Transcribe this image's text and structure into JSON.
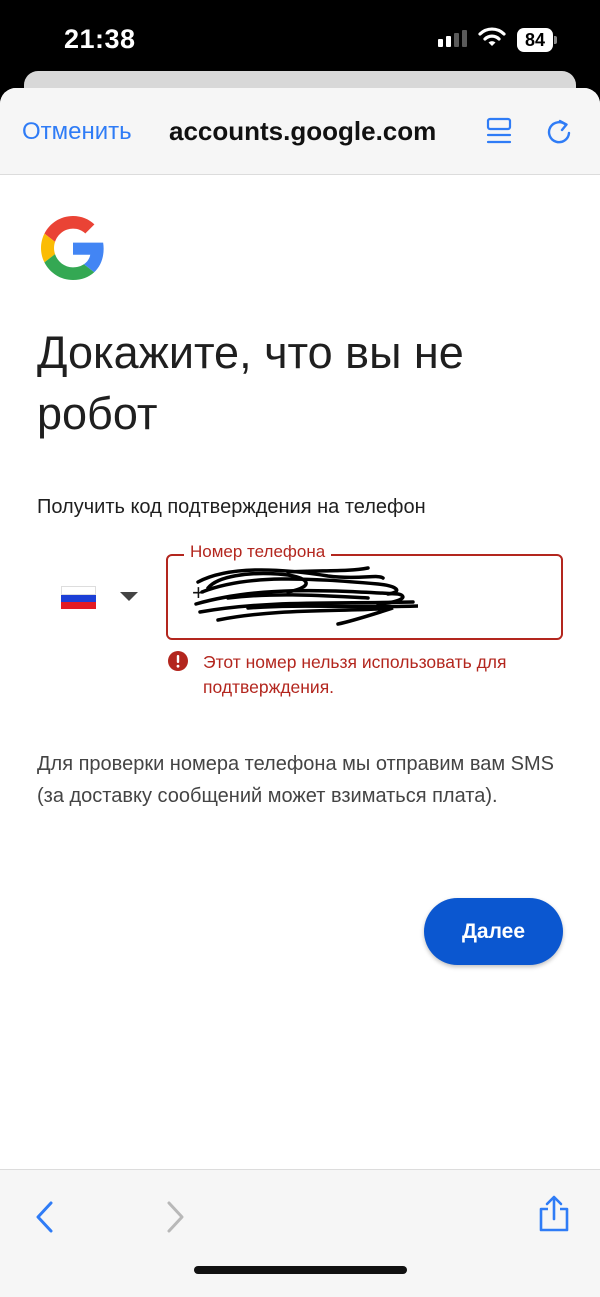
{
  "status_bar": {
    "time": "21:38",
    "battery_level": "84",
    "icons": [
      "cellular-signal-icon",
      "wifi-icon",
      "battery-icon"
    ]
  },
  "browser_nav": {
    "cancel_label": "Отменить",
    "url": "accounts.google.com",
    "icons": [
      "reader-mode-icon",
      "reload-icon"
    ]
  },
  "page": {
    "title": "Докажите, что вы не робот",
    "subtitle": "Получить код подтверждения на телефон",
    "country": {
      "flag": "russia-flag",
      "flag_colors": [
        "#ffffff",
        "#1c3fd6",
        "#e31b23"
      ]
    },
    "phone_field": {
      "label": "Номер телефона",
      "value_prefix": "+"
    },
    "error": {
      "message": "Этот номер нельзя использовать для подтверждения."
    },
    "info": "Для проверки номера телефона мы отправим вам SMS (за доставку сообщений может взиматься плата).",
    "next_button": "Далее"
  },
  "toolbar": {
    "icons": [
      "back-icon",
      "forward-icon",
      "share-icon"
    ]
  },
  "colors": {
    "accent_blue": "#2f7cf6",
    "button_blue": "#0b57d0",
    "error_red": "#b3261e"
  }
}
